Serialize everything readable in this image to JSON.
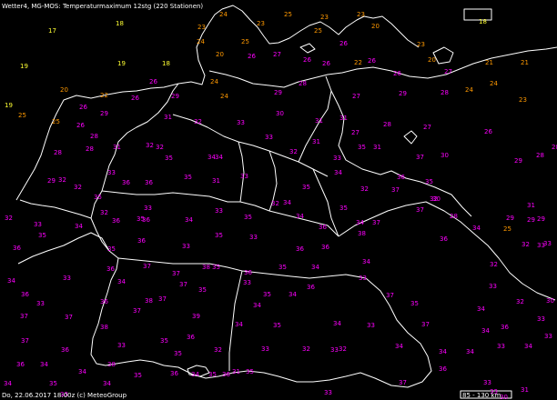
{
  "header": {
    "title": "Wetter4, MG-MOS: Temperaturmaximum 12stg (220 Stationen)"
  },
  "footer": {
    "caption": "Do, 22.06.2017 18:00z (c) MeteoGroup",
    "scale": "85 - 130 km"
  },
  "colors": {
    "background": "#000000",
    "borders": "#ffffff",
    "coast_water": "#ffffff",
    "value_low": "#ffff33",
    "value_mid": "#ff9900",
    "value_high": "#ff00ff"
  },
  "legend_thresholds": {
    "mid_from": 20,
    "high_from": 26
  },
  "stations": [
    [
      "17",
      53,
      30
    ],
    [
      "18",
      127,
      22
    ],
    [
      "19",
      22,
      69
    ],
    [
      "19",
      129,
      66
    ],
    [
      "18",
      178,
      66
    ],
    [
      "20",
      66,
      95
    ],
    [
      "19",
      5,
      112
    ],
    [
      "22",
      110,
      101
    ],
    [
      "24",
      241,
      12
    ],
    [
      "23",
      352,
      15
    ],
    [
      "23",
      282,
      22
    ],
    [
      "25",
      312,
      12
    ],
    [
      "23",
      392,
      12
    ],
    [
      "23",
      217,
      26
    ],
    [
      "24",
      216,
      42
    ],
    [
      "25",
      265,
      42
    ],
    [
      "20",
      237,
      56
    ],
    [
      "25",
      345,
      30
    ],
    [
      "26",
      373,
      44
    ],
    [
      "20",
      408,
      25
    ],
    [
      "18",
      526,
      20
    ],
    [
      "23",
      458,
      45
    ],
    [
      "26",
      404,
      63
    ],
    [
      "21",
      533,
      65
    ],
    [
      "21",
      572,
      65
    ],
    [
      "20",
      470,
      62
    ],
    [
      "24",
      538,
      88
    ],
    [
      "23",
      570,
      106
    ],
    [
      "22",
      389,
      65
    ],
    [
      "24",
      511,
      95
    ],
    [
      "26",
      272,
      58
    ],
    [
      "27",
      300,
      56
    ],
    [
      "26",
      333,
      62
    ],
    [
      "26",
      354,
      66
    ],
    [
      "26",
      432,
      77
    ],
    [
      "27",
      488,
      75
    ],
    [
      "24",
      231,
      86
    ],
    [
      "29",
      301,
      98
    ],
    [
      "28",
      328,
      88
    ],
    [
      "27",
      387,
      102
    ],
    [
      "29",
      438,
      99
    ],
    [
      "28",
      484,
      98
    ],
    [
      "26",
      164,
      86
    ],
    [
      "29",
      188,
      102
    ],
    [
      "26",
      144,
      104
    ],
    [
      "26",
      87,
      114
    ],
    [
      "29",
      110,
      121
    ],
    [
      "26",
      84,
      134
    ],
    [
      "28",
      99,
      146
    ],
    [
      "25",
      57,
      130
    ],
    [
      "25",
      20,
      123
    ],
    [
      "24",
      242,
      102
    ],
    [
      "31",
      180,
      125
    ],
    [
      "32",
      213,
      130
    ],
    [
      "33",
      260,
      131
    ],
    [
      "30",
      303,
      121
    ],
    [
      "31",
      346,
      129
    ],
    [
      "31",
      373,
      126
    ],
    [
      "27",
      386,
      142
    ],
    [
      "28",
      421,
      133
    ],
    [
      "27",
      465,
      136
    ],
    [
      "26",
      532,
      141
    ],
    [
      "29",
      565,
      173
    ],
    [
      "28",
      606,
      158
    ],
    [
      "28",
      589,
      167
    ],
    [
      "28",
      59,
      164
    ],
    [
      "28",
      94,
      160
    ],
    [
      "31",
      124,
      158
    ],
    [
      "32",
      160,
      156
    ],
    [
      "32",
      171,
      158
    ],
    [
      "33",
      291,
      147
    ],
    [
      "31",
      343,
      152
    ],
    [
      "30",
      484,
      167
    ],
    [
      "31",
      410,
      158
    ],
    [
      "32",
      318,
      163
    ],
    [
      "33",
      366,
      170
    ],
    [
      "35",
      393,
      158
    ],
    [
      "36",
      436,
      191
    ],
    [
      "37",
      457,
      169
    ],
    [
      "35",
      467,
      196
    ],
    [
      "35",
      181,
      170
    ],
    [
      "34",
      228,
      169
    ],
    [
      "34",
      236,
      169
    ],
    [
      "33",
      264,
      190
    ],
    [
      "33",
      118,
      186
    ],
    [
      "36",
      134,
      197
    ],
    [
      "35",
      202,
      191
    ],
    [
      "31",
      233,
      195
    ],
    [
      "34",
      367,
      186
    ],
    [
      "32",
      64,
      194
    ],
    [
      "29",
      52,
      195
    ],
    [
      "32",
      81,
      202
    ],
    [
      "35",
      103,
      213
    ],
    [
      "33",
      158,
      225
    ],
    [
      "36",
      159,
      197
    ],
    [
      "35",
      332,
      202
    ],
    [
      "32",
      298,
      220
    ],
    [
      "34",
      311,
      219
    ],
    [
      "35",
      373,
      225
    ],
    [
      "37",
      430,
      205
    ],
    [
      "32",
      472,
      215
    ],
    [
      "32",
      396,
      204
    ],
    [
      "30",
      475,
      215
    ],
    [
      "31",
      579,
      222
    ],
    [
      "29",
      556,
      236
    ],
    [
      "33",
      37,
      243
    ],
    [
      "32",
      5,
      236
    ],
    [
      "34",
      82,
      245
    ],
    [
      "36",
      123,
      239
    ],
    [
      "35",
      150,
      237
    ],
    [
      "32",
      110,
      230
    ],
    [
      "36",
      156,
      238
    ],
    [
      "33",
      236,
      228
    ],
    [
      "34",
      203,
      238
    ],
    [
      "35",
      268,
      235
    ],
    [
      "34",
      325,
      234
    ],
    [
      "36",
      350,
      246
    ],
    [
      "34",
      391,
      241
    ],
    [
      "37",
      409,
      241
    ],
    [
      "37",
      457,
      227
    ],
    [
      "34",
      519,
      247
    ],
    [
      "28",
      494,
      234
    ],
    [
      "25",
      553,
      248
    ],
    [
      "29",
      579,
      238
    ],
    [
      "29",
      590,
      237
    ],
    [
      "35",
      42,
      255
    ],
    [
      "36",
      483,
      259
    ],
    [
      "33",
      597,
      264
    ],
    [
      "33",
      590,
      266
    ],
    [
      "35",
      236,
      255
    ],
    [
      "33",
      274,
      257
    ],
    [
      "36",
      325,
      270
    ],
    [
      "36",
      353,
      268
    ],
    [
      "38",
      393,
      253
    ],
    [
      "32",
      573,
      265
    ],
    [
      "34",
      8,
      305
    ],
    [
      "33",
      69,
      302
    ],
    [
      "36",
      117,
      292
    ],
    [
      "37",
      157,
      289
    ],
    [
      "37",
      189,
      297
    ],
    [
      "35",
      233,
      290
    ],
    [
      "36",
      268,
      296
    ],
    [
      "35",
      306,
      290
    ],
    [
      "34",
      342,
      290
    ],
    [
      "34",
      398,
      284
    ],
    [
      "33",
      394,
      302
    ],
    [
      "32",
      538,
      287
    ],
    [
      "36",
      14,
      269
    ],
    [
      "35",
      118,
      270
    ],
    [
      "36",
      151,
      261
    ],
    [
      "33",
      200,
      267
    ],
    [
      "34",
      129,
      306
    ],
    [
      "37",
      197,
      309
    ],
    [
      "35",
      218,
      315
    ],
    [
      "38",
      222,
      290
    ],
    [
      "33",
      267,
      307
    ],
    [
      "35",
      289,
      320
    ],
    [
      "34",
      317,
      320
    ],
    [
      "36",
      337,
      312
    ],
    [
      "37",
      424,
      321
    ],
    [
      "33",
      537,
      311
    ],
    [
      "32",
      567,
      328
    ],
    [
      "30",
      600,
      327
    ],
    [
      "36",
      23,
      320
    ],
    [
      "33",
      40,
      330
    ],
    [
      "36",
      110,
      328
    ],
    [
      "37",
      22,
      344
    ],
    [
      "38",
      110,
      356
    ],
    [
      "38",
      159,
      327
    ],
    [
      "37",
      146,
      338
    ],
    [
      "37",
      174,
      325
    ],
    [
      "39",
      211,
      344
    ],
    [
      "34",
      278,
      332
    ],
    [
      "34",
      258,
      353
    ],
    [
      "35",
      300,
      354
    ],
    [
      "34",
      366,
      352
    ],
    [
      "33",
      403,
      354
    ],
    [
      "35",
      451,
      330
    ],
    [
      "37",
      463,
      353
    ],
    [
      "34",
      524,
      336
    ],
    [
      "34",
      529,
      360
    ],
    [
      "36",
      550,
      356
    ],
    [
      "33",
      590,
      347
    ],
    [
      "37",
      71,
      345
    ],
    [
      "37",
      23,
      371
    ],
    [
      "36",
      67,
      381
    ],
    [
      "33",
      129,
      376
    ],
    [
      "35",
      176,
      371
    ],
    [
      "35",
      191,
      385
    ],
    [
      "36",
      205,
      367
    ],
    [
      "32",
      235,
      381
    ],
    [
      "33",
      287,
      380
    ],
    [
      "32",
      332,
      380
    ],
    [
      "33",
      363,
      381
    ],
    [
      "32",
      372,
      380
    ],
    [
      "34",
      434,
      377
    ],
    [
      "34",
      482,
      383
    ],
    [
      "34",
      512,
      383
    ],
    [
      "33",
      546,
      377
    ],
    [
      "34",
      576,
      377
    ],
    [
      "33",
      598,
      366
    ],
    [
      "36",
      18,
      397
    ],
    [
      "34",
      44,
      397
    ],
    [
      "34",
      86,
      405
    ],
    [
      "38",
      118,
      397
    ],
    [
      "35",
      147,
      409
    ],
    [
      "36",
      187,
      407
    ],
    [
      "34",
      210,
      408
    ],
    [
      "35",
      229,
      408
    ],
    [
      "36",
      244,
      408
    ],
    [
      "31",
      255,
      405
    ],
    [
      "35",
      270,
      405
    ],
    [
      "33",
      356,
      428
    ],
    [
      "37",
      438,
      417
    ],
    [
      "36",
      482,
      402
    ],
    [
      "33",
      531,
      417
    ],
    [
      "30",
      549,
      433
    ],
    [
      "33",
      538,
      427
    ],
    [
      "31",
      572,
      425
    ],
    [
      "34",
      4,
      418
    ],
    [
      "35",
      54,
      418
    ],
    [
      "33",
      66,
      430
    ],
    [
      "34",
      113,
      418
    ]
  ]
}
